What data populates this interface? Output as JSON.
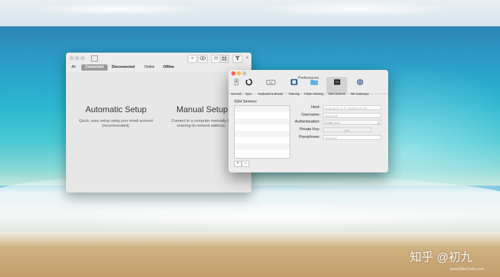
{
  "main_window": {
    "tabs": [
      "All",
      "Connected",
      "Disconnected",
      "Online",
      "Offline"
    ],
    "toolbar": {
      "add": "+",
      "more": "»"
    },
    "automatic_setup": {
      "title": "Automatic Setup",
      "description": "Quick, easy setup using your email account (recommended)."
    },
    "manual_setup": {
      "title": "Manual Setup",
      "description": "Connect to a computer manually by entering its network address."
    }
  },
  "preferences_window": {
    "title": "Preferences",
    "toolbar": [
      {
        "label": "General",
        "icon": "general-icon"
      },
      {
        "label": "Sync",
        "icon": "sync-icon"
      },
      {
        "label": "Keyboard & Mouse",
        "icon": "keyboard-icon"
      },
      {
        "label": "Panning",
        "icon": "panning-icon"
      },
      {
        "label": "Folder Sharing",
        "icon": "folder-icon"
      },
      {
        "label": "SSH Servers",
        "icon": "ssh-icon"
      },
      {
        "label": "RD Gateways",
        "icon": "globe-icon"
      }
    ],
    "selected_tab": "SSH Servers",
    "ssh_servers_label": "SSH Servers:",
    "list_buttons": {
      "add": "+",
      "remove": "−"
    },
    "form": {
      "host_label": "Host:",
      "host_placeholder": "Hostname or IP address[:Port]",
      "username_label": "Username:",
      "username_placeholder": "Required",
      "auth_label": "Authentication:",
      "auth_value": "Public Key",
      "private_key_label": "Private Key:",
      "private_key_button": "Set...",
      "passphrase_label": "Passphrase:",
      "passphrase_placeholder": "Optional"
    },
    "colors": {
      "close": "#fc5d57",
      "minimize": "#fdbc40"
    }
  },
  "watermark": {
    "main": "知乎 @初九",
    "sub": "www.MacDown.com"
  }
}
